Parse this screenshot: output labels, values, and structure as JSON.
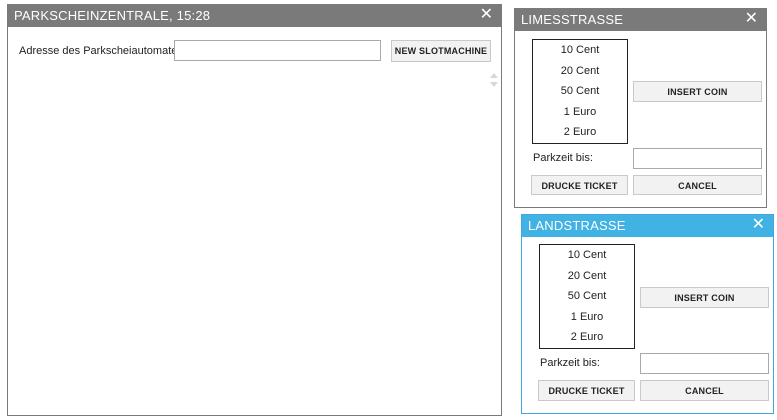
{
  "central": {
    "title": "PARKSCHEINZENTRALE, 15:28",
    "close_glyph": "✕",
    "address_label": "Adresse des Parkscheiautomaten:",
    "address_value": "",
    "new_button": "NEW SLOTMACHINE"
  },
  "machines": [
    {
      "title": "LIMESSTRASSE",
      "close_glyph": "✕",
      "coins": [
        "10 Cent",
        "20 Cent",
        "50 Cent",
        "1 Euro",
        "2 Euro"
      ],
      "insert_button": "INSERT COIN",
      "parkzeit_label": "Parkzeit bis:",
      "parkzeit_value": "",
      "print_button": "DRUCKE TICKET",
      "cancel_button": "CANCEL"
    },
    {
      "title": "LANDSTRASSE",
      "close_glyph": "✕",
      "coins": [
        "10 Cent",
        "20 Cent",
        "50 Cent",
        "1 Euro",
        "2 Euro"
      ],
      "insert_button": "INSERT COIN",
      "parkzeit_label": "Parkzeit bis:",
      "parkzeit_value": "",
      "print_button": "DRUCKE TICKET",
      "cancel_button": "CANCEL"
    }
  ]
}
